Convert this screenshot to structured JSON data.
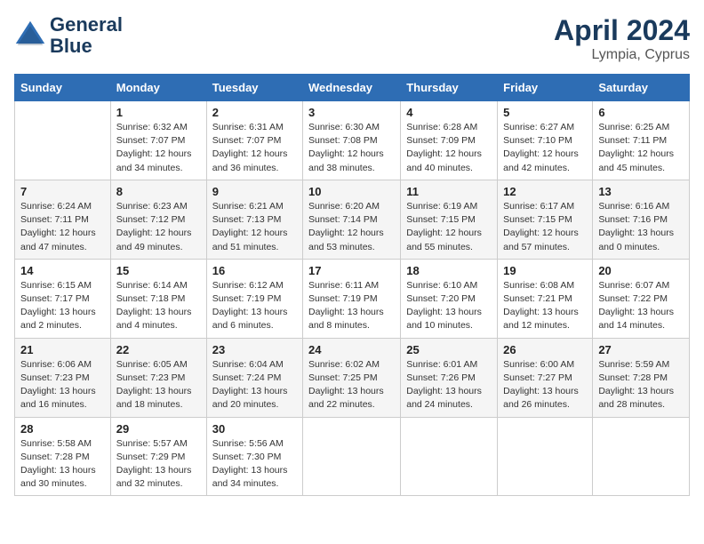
{
  "header": {
    "logo_line1": "General",
    "logo_line2": "Blue",
    "month": "April 2024",
    "location": "Lympia, Cyprus"
  },
  "weekdays": [
    "Sunday",
    "Monday",
    "Tuesday",
    "Wednesday",
    "Thursday",
    "Friday",
    "Saturday"
  ],
  "weeks": [
    [
      {
        "day": "",
        "info": ""
      },
      {
        "day": "1",
        "info": "Sunrise: 6:32 AM\nSunset: 7:07 PM\nDaylight: 12 hours\nand 34 minutes."
      },
      {
        "day": "2",
        "info": "Sunrise: 6:31 AM\nSunset: 7:07 PM\nDaylight: 12 hours\nand 36 minutes."
      },
      {
        "day": "3",
        "info": "Sunrise: 6:30 AM\nSunset: 7:08 PM\nDaylight: 12 hours\nand 38 minutes."
      },
      {
        "day": "4",
        "info": "Sunrise: 6:28 AM\nSunset: 7:09 PM\nDaylight: 12 hours\nand 40 minutes."
      },
      {
        "day": "5",
        "info": "Sunrise: 6:27 AM\nSunset: 7:10 PM\nDaylight: 12 hours\nand 42 minutes."
      },
      {
        "day": "6",
        "info": "Sunrise: 6:25 AM\nSunset: 7:11 PM\nDaylight: 12 hours\nand 45 minutes."
      }
    ],
    [
      {
        "day": "7",
        "info": "Sunrise: 6:24 AM\nSunset: 7:11 PM\nDaylight: 12 hours\nand 47 minutes."
      },
      {
        "day": "8",
        "info": "Sunrise: 6:23 AM\nSunset: 7:12 PM\nDaylight: 12 hours\nand 49 minutes."
      },
      {
        "day": "9",
        "info": "Sunrise: 6:21 AM\nSunset: 7:13 PM\nDaylight: 12 hours\nand 51 minutes."
      },
      {
        "day": "10",
        "info": "Sunrise: 6:20 AM\nSunset: 7:14 PM\nDaylight: 12 hours\nand 53 minutes."
      },
      {
        "day": "11",
        "info": "Sunrise: 6:19 AM\nSunset: 7:15 PM\nDaylight: 12 hours\nand 55 minutes."
      },
      {
        "day": "12",
        "info": "Sunrise: 6:17 AM\nSunset: 7:15 PM\nDaylight: 12 hours\nand 57 minutes."
      },
      {
        "day": "13",
        "info": "Sunrise: 6:16 AM\nSunset: 7:16 PM\nDaylight: 13 hours\nand 0 minutes."
      }
    ],
    [
      {
        "day": "14",
        "info": "Sunrise: 6:15 AM\nSunset: 7:17 PM\nDaylight: 13 hours\nand 2 minutes."
      },
      {
        "day": "15",
        "info": "Sunrise: 6:14 AM\nSunset: 7:18 PM\nDaylight: 13 hours\nand 4 minutes."
      },
      {
        "day": "16",
        "info": "Sunrise: 6:12 AM\nSunset: 7:19 PM\nDaylight: 13 hours\nand 6 minutes."
      },
      {
        "day": "17",
        "info": "Sunrise: 6:11 AM\nSunset: 7:19 PM\nDaylight: 13 hours\nand 8 minutes."
      },
      {
        "day": "18",
        "info": "Sunrise: 6:10 AM\nSunset: 7:20 PM\nDaylight: 13 hours\nand 10 minutes."
      },
      {
        "day": "19",
        "info": "Sunrise: 6:08 AM\nSunset: 7:21 PM\nDaylight: 13 hours\nand 12 minutes."
      },
      {
        "day": "20",
        "info": "Sunrise: 6:07 AM\nSunset: 7:22 PM\nDaylight: 13 hours\nand 14 minutes."
      }
    ],
    [
      {
        "day": "21",
        "info": "Sunrise: 6:06 AM\nSunset: 7:23 PM\nDaylight: 13 hours\nand 16 minutes."
      },
      {
        "day": "22",
        "info": "Sunrise: 6:05 AM\nSunset: 7:23 PM\nDaylight: 13 hours\nand 18 minutes."
      },
      {
        "day": "23",
        "info": "Sunrise: 6:04 AM\nSunset: 7:24 PM\nDaylight: 13 hours\nand 20 minutes."
      },
      {
        "day": "24",
        "info": "Sunrise: 6:02 AM\nSunset: 7:25 PM\nDaylight: 13 hours\nand 22 minutes."
      },
      {
        "day": "25",
        "info": "Sunrise: 6:01 AM\nSunset: 7:26 PM\nDaylight: 13 hours\nand 24 minutes."
      },
      {
        "day": "26",
        "info": "Sunrise: 6:00 AM\nSunset: 7:27 PM\nDaylight: 13 hours\nand 26 minutes."
      },
      {
        "day": "27",
        "info": "Sunrise: 5:59 AM\nSunset: 7:28 PM\nDaylight: 13 hours\nand 28 minutes."
      }
    ],
    [
      {
        "day": "28",
        "info": "Sunrise: 5:58 AM\nSunset: 7:28 PM\nDaylight: 13 hours\nand 30 minutes."
      },
      {
        "day": "29",
        "info": "Sunrise: 5:57 AM\nSunset: 7:29 PM\nDaylight: 13 hours\nand 32 minutes."
      },
      {
        "day": "30",
        "info": "Sunrise: 5:56 AM\nSunset: 7:30 PM\nDaylight: 13 hours\nand 34 minutes."
      },
      {
        "day": "",
        "info": ""
      },
      {
        "day": "",
        "info": ""
      },
      {
        "day": "",
        "info": ""
      },
      {
        "day": "",
        "info": ""
      }
    ]
  ]
}
